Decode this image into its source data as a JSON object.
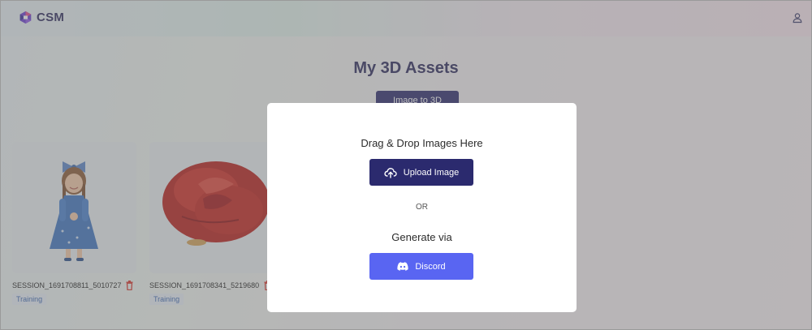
{
  "header": {
    "brand": "CSM",
    "user_icon": "user-icon",
    "colors": {
      "brand": "#2d2a5e"
    }
  },
  "main": {
    "title": "My 3D Assets",
    "active_tab": "Image to 3D"
  },
  "assets": [
    {
      "name": "SESSION_1691708811_5010727",
      "status": "Training",
      "thumbnail": "girl-in-blue-dress"
    },
    {
      "name": "SESSION_1691708341_5219680",
      "status": "Training",
      "thumbnail": "red-rose"
    }
  ],
  "modal": {
    "heading": "Drag & Drop Images Here",
    "upload_label": "Upload Image",
    "or_label": "OR",
    "generate_label": "Generate via",
    "discord_label": "Discord",
    "colors": {
      "upload": "#2b2a6e",
      "discord": "#5965f2"
    }
  }
}
